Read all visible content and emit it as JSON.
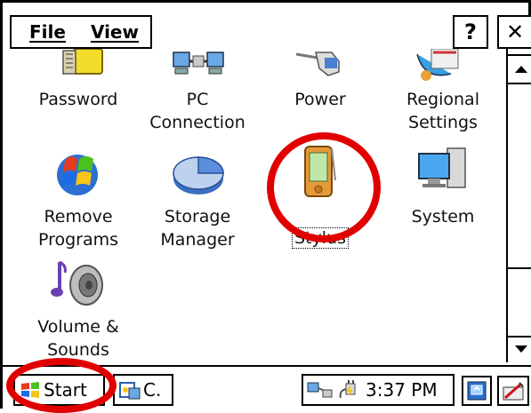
{
  "menu": {
    "file_label": "File",
    "view_label": "View"
  },
  "title_buttons": {
    "help_label": "?",
    "close_label": "✕"
  },
  "icons": [
    {
      "label": "Password"
    },
    {
      "label": "PC\nConnection"
    },
    {
      "label": "Power"
    },
    {
      "label": "Regional\nSettings"
    },
    {
      "label": "Remove\nPrograms"
    },
    {
      "label": "Storage\nManager"
    },
    {
      "label": "Stylus",
      "selected": true
    },
    {
      "label": "System"
    },
    {
      "label": "Volume &\nSounds"
    }
  ],
  "taskbar": {
    "start_label": "Start",
    "task_label": "C.",
    "clock": "3:37 PM"
  },
  "colors": {
    "highlight_ring": "#e10000"
  }
}
